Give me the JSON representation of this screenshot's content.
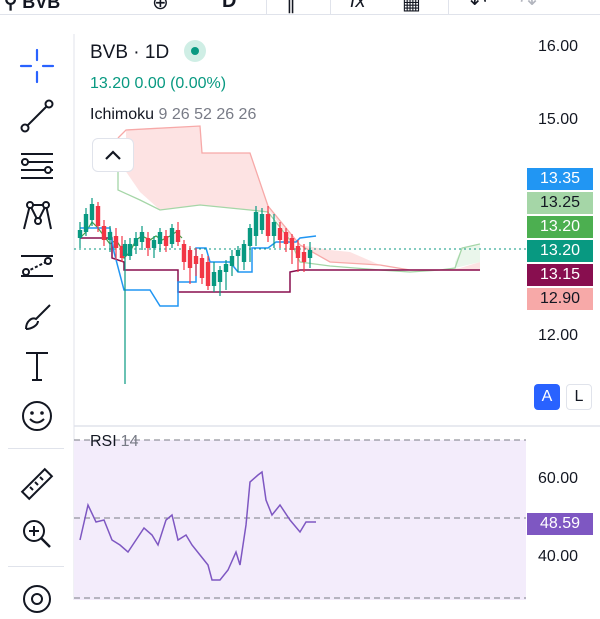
{
  "topbar": {
    "symbol": "BVB",
    "interval": "D"
  },
  "legend": {
    "title": "BVB · 1D",
    "ohlc": "13.20  0.00 (0.00%)",
    "indicator_name": "Ichimoku",
    "indicator_params": "9 26 52 26 26"
  },
  "price_axis": {
    "labels": [
      "16.00",
      "15.00",
      "12.00"
    ],
    "tags": [
      {
        "value": "13.35",
        "color": "#2196f3"
      },
      {
        "value": "13.25",
        "color": "#a5d6a7"
      },
      {
        "value": "13.20",
        "color": "#4caf50"
      },
      {
        "value": "13.20",
        "color": "#089981"
      },
      {
        "value": "13.15",
        "color": "#880e4f"
      },
      {
        "value": "12.90",
        "color": "#f7a9a8"
      }
    ]
  },
  "scale_buttons": {
    "auto": "A",
    "log": "L"
  },
  "rsi": {
    "name": "RSI",
    "length": "14",
    "value": "48.59",
    "value_color": "#7e57c2",
    "axis_labels": [
      "60.00",
      "40.00"
    ]
  },
  "tools": [
    "crosshair-icon",
    "trendline-icon",
    "fib-icon",
    "pattern-icon",
    "prediction-icon",
    "brush-icon",
    "text-icon",
    "emoji-icon",
    "ruler-icon",
    "zoom-icon",
    "magnet-icon"
  ],
  "colors": {
    "up": "#089981",
    "down": "#f23645",
    "cloud_bear": "#fde0e0",
    "rsi_line": "#7e57c2",
    "rsi_bg": "#f2ecfb"
  }
}
